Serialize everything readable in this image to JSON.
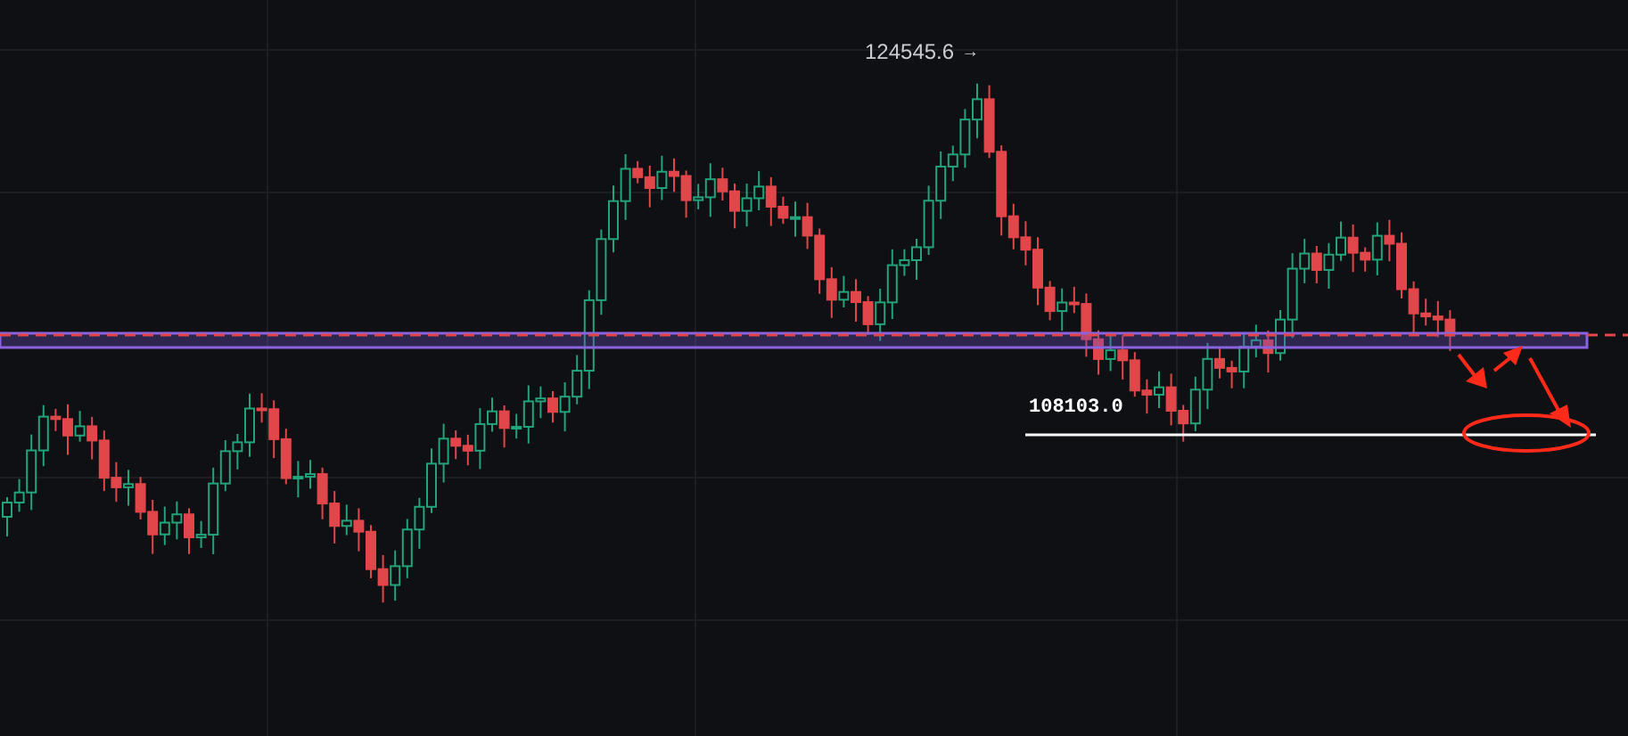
{
  "chart": {
    "high_label": "124545.6",
    "high_arrow": "→",
    "level_label": "108103.0"
  }
}
